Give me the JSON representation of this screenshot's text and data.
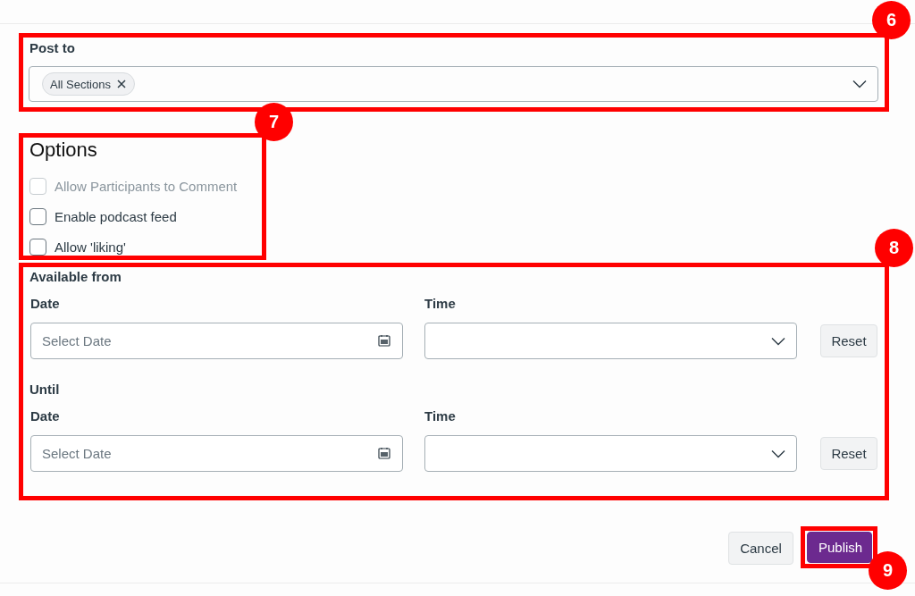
{
  "post_to": {
    "label": "Post to",
    "tags": [
      {
        "label": "All Sections"
      }
    ]
  },
  "options": {
    "heading": "Options",
    "items": [
      {
        "label": "Allow Participants to Comment",
        "checked": false,
        "disabled": true
      },
      {
        "label": "Enable podcast feed",
        "checked": false,
        "disabled": false
      },
      {
        "label": "Allow 'liking'",
        "checked": false,
        "disabled": false
      }
    ]
  },
  "availability": [
    {
      "heading": "Available from",
      "date_label": "Date",
      "date_placeholder": "Select Date",
      "time_label": "Time",
      "reset": "Reset"
    },
    {
      "heading": "Until",
      "date_label": "Date",
      "date_placeholder": "Select Date",
      "time_label": "Time",
      "reset": "Reset"
    }
  ],
  "buttons": [
    {
      "label": "Cancel",
      "kind": "secondary"
    },
    {
      "label": "Publish",
      "kind": "primary"
    }
  ],
  "callouts": [
    {
      "number": "6"
    },
    {
      "number": "7"
    },
    {
      "number": "8"
    },
    {
      "number": "9"
    }
  ]
}
